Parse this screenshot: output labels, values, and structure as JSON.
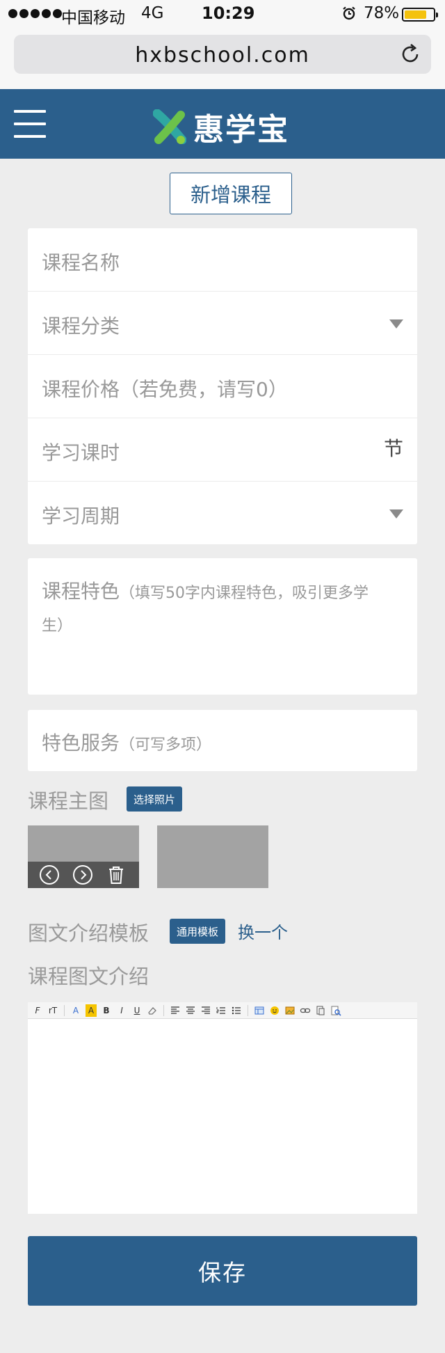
{
  "status_bar": {
    "carrier": "中国移动",
    "network": "4G",
    "time": "10:29",
    "battery_percent": "78%",
    "battery_level": 0.78
  },
  "browser": {
    "url": "hxbschool.com"
  },
  "header": {
    "brand": "惠学宝"
  },
  "page": {
    "title_button": "新增课程"
  },
  "form": {
    "fields": [
      {
        "placeholder": "课程名称"
      },
      {
        "placeholder": "课程分类"
      },
      {
        "placeholder": "课程价格（若免费，请写0）"
      },
      {
        "placeholder": "学习课时",
        "unit": "节"
      },
      {
        "placeholder": "学习周期"
      }
    ],
    "feature": {
      "label": "课程特色",
      "hint": "（填写50字内课程特色，吸引更多学生）"
    },
    "service": {
      "label": "特色服务",
      "hint": "（可写多项）"
    }
  },
  "main_image": {
    "label": "课程主图",
    "choose_button": "选择照片"
  },
  "template": {
    "label": "图文介绍模板",
    "badge": "通用模板",
    "switch_link": "换一个"
  },
  "intro": {
    "label": "课程图文介绍"
  },
  "editor_toolbar": {
    "font": "F",
    "size": "rT",
    "font_color": "A",
    "bg_color": "A",
    "bold": "B",
    "italic": "I",
    "underline": "U"
  },
  "save_button": "保存",
  "colors": {
    "primary": "#2b5f8c",
    "background": "#ededed"
  }
}
